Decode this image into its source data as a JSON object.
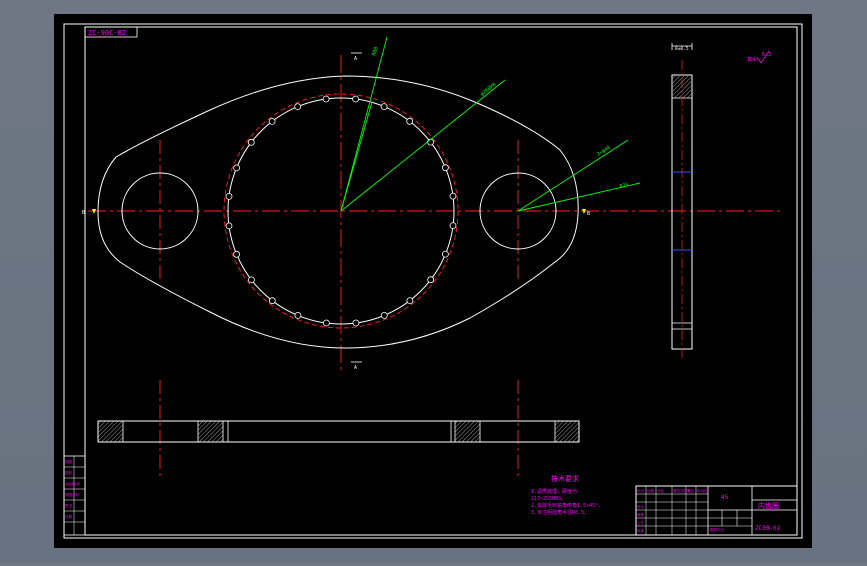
{
  "drawing": {
    "corner_code": "ZC-90C-02",
    "section_mark_top": "A",
    "section_mark_bottom": "A",
    "view_mark_left": "B",
    "view_mark_right": "B",
    "dim_thickness": "8±0.5",
    "roughness_top": "6.3",
    "roughness_note": "其余",
    "dim_labels": [
      "R80",
      "φ260H8",
      "2×φ46",
      "R25"
    ],
    "tech_req": {
      "title": "技术要求",
      "lines": [
        "1.调质处理，硬度为",
        "217~255HBS。",
        "2.去除毛刺锐角倒角1.5×45°。",
        "3.未注明圆角半径R0.5。"
      ]
    },
    "title_block": {
      "material": "45",
      "part_name": "内齿圈",
      "drawing_no": "ZC09-02",
      "scale_label": "图样标记"
    },
    "revision_labels": [
      "描图",
      "描校",
      "旧底图总号",
      "底图总号",
      "签字",
      "日期"
    ]
  }
}
